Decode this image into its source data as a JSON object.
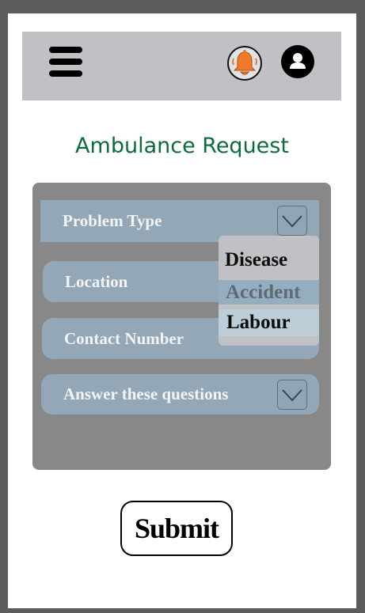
{
  "header": {
    "menu_icon": "hamburger-menu-icon",
    "notification_icon": "bell-icon",
    "profile_icon": "user-account-icon"
  },
  "page": {
    "title": "Ambulance Request"
  },
  "form": {
    "problem_type": {
      "label": "Problem Type",
      "options": [
        "Disease",
        "Accident",
        "Labour"
      ],
      "highlighted": "Accident"
    },
    "location": {
      "label": "Location"
    },
    "contact": {
      "label": "Contact Number"
    },
    "questions": {
      "label": "Answer these questions"
    },
    "submit_label": "Submit"
  },
  "colors": {
    "title": "#0e6b3a",
    "topbar": "#c0c1c5",
    "panel": "#888888",
    "field": "#93a7b7",
    "bell": "#f07a28"
  }
}
